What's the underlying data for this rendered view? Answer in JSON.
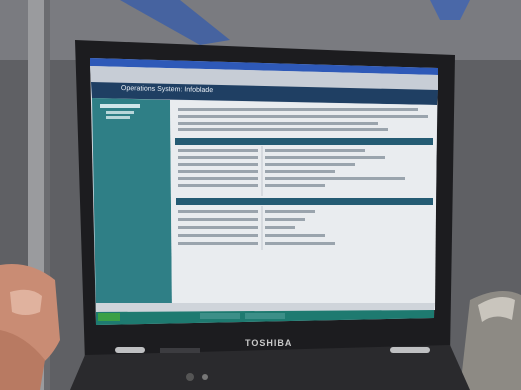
{
  "laptop": {
    "brand": "TOSHIBA",
    "screen_app_title": "Operations System: Infoblade"
  },
  "colors": {
    "floor": "#6e6e70",
    "bezel": "#1c1c1f",
    "screen_sidebar": "#2f7f86",
    "screen_header": "#1f3f63",
    "taskbar": "#1e7a70"
  }
}
